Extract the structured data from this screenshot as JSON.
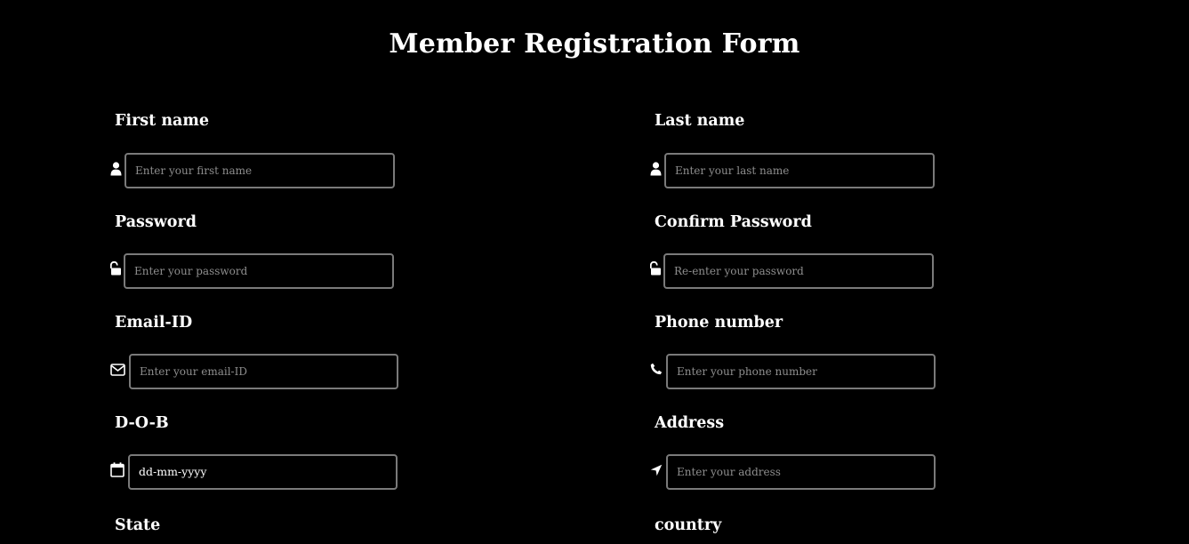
{
  "form": {
    "title": "Member Registration Form",
    "fields": {
      "first_name": {
        "label": "First name",
        "placeholder": "Enter your first name",
        "icon": "user-icon"
      },
      "last_name": {
        "label": "Last name",
        "placeholder": "Enter your last name",
        "icon": "user-icon"
      },
      "password": {
        "label": "Password",
        "placeholder": "Enter your password",
        "icon": "unlock-icon"
      },
      "confirm_password": {
        "label": "Confirm Password",
        "placeholder": "Re-enter your password",
        "icon": "unlock-icon"
      },
      "email": {
        "label": "Email-ID",
        "placeholder": "Enter your email-ID",
        "icon": "envelope-icon"
      },
      "phone": {
        "label": "Phone number",
        "placeholder": "Enter your phone number",
        "icon": "phone-icon"
      },
      "dob": {
        "label": "D-O-B",
        "value": "dd-mm-yyyy",
        "icon": "calendar-icon"
      },
      "address": {
        "label": "Address",
        "placeholder": "Enter your address",
        "icon": "location-arrow-icon"
      },
      "state": {
        "label": "State"
      },
      "country": {
        "label": "country"
      }
    }
  },
  "colors": {
    "background": "#000000",
    "text": "#ffffff",
    "input_border": "#7a7a7a",
    "placeholder": "#8e8e8e"
  }
}
